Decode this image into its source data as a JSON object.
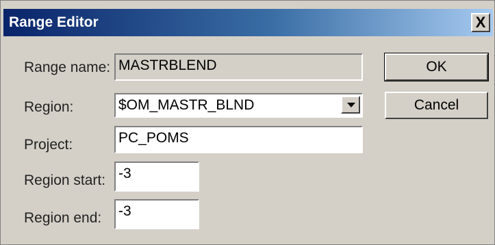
{
  "window": {
    "title": "Range Editor",
    "close_glyph": "X"
  },
  "labels": {
    "range_name": "Range name:",
    "region": "Region:",
    "project": "Project:",
    "region_start": "Region start:",
    "region_end": "Region end:"
  },
  "fields": {
    "range_name": "MASTRBLEND",
    "region": "$OM_MASTR_BLND",
    "project": "PC_POMS",
    "region_start": "-3",
    "region_end": "-3"
  },
  "buttons": {
    "ok": "OK",
    "cancel": "Cancel"
  }
}
